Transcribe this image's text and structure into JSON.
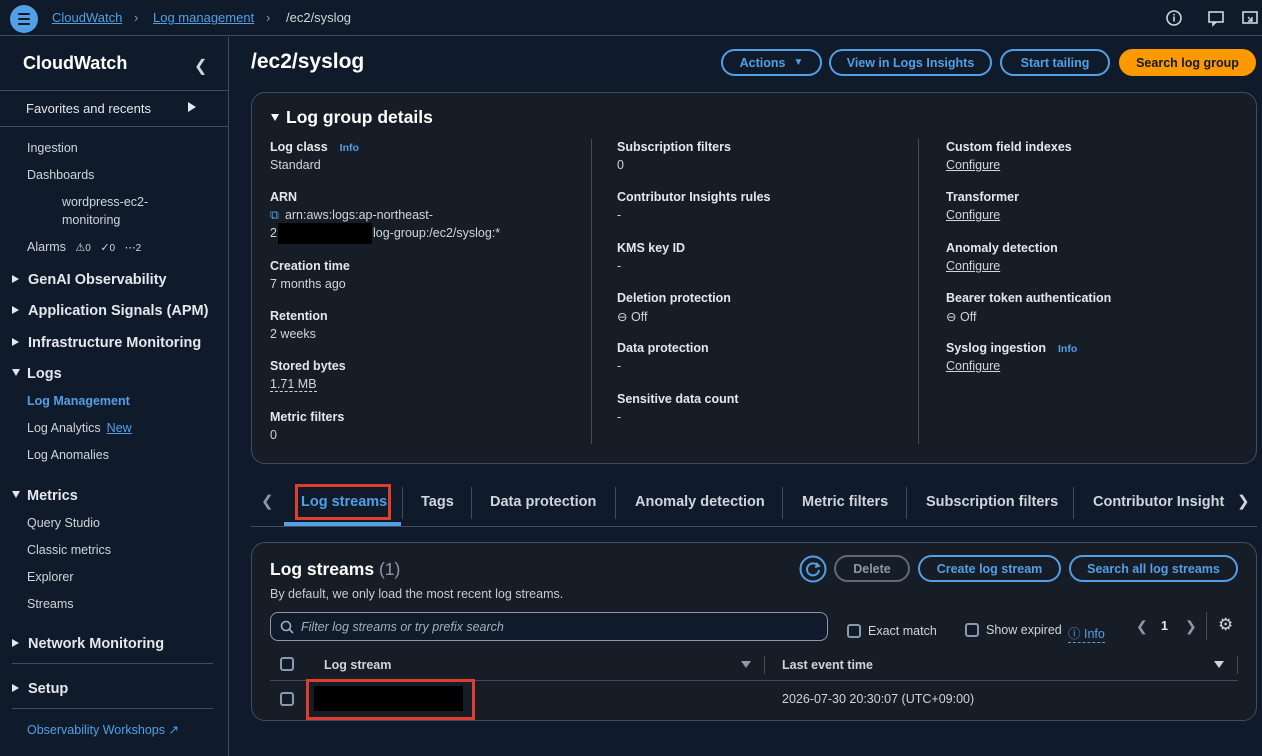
{
  "breadcrumb": {
    "items": [
      "CloudWatch",
      "Log management"
    ],
    "current": "/ec2/syslog"
  },
  "sidebar": {
    "title": "CloudWatch",
    "favorites_label": "Favorites and recents",
    "items": [
      "Ingestion",
      "Dashboards",
      "wordpress-ec2-",
      "monitoring"
    ],
    "alarms_label": "Alarms",
    "alarm_counts": [
      "0",
      "0",
      "2"
    ],
    "groups": {
      "genai": "GenAI Observability",
      "apm": "Application Signals (APM)",
      "infra": "Infrastructure Monitoring",
      "logs": "Logs",
      "metrics": "Metrics",
      "network": "Network Monitoring",
      "setup": "Setup"
    },
    "logs_items": [
      "Log Management",
      "Log Analytics",
      "Log Anomalies"
    ],
    "new_badge": "New",
    "metrics_items": [
      "Query Studio",
      "Classic metrics",
      "Explorer",
      "Streams"
    ],
    "workshops": "Observability Workshops"
  },
  "page": {
    "title": "/ec2/syslog",
    "actions_label": "Actions",
    "insights_label": "View in Logs Insights",
    "tailing_label": "Start tailing",
    "search_group_label": "Search log group"
  },
  "details": {
    "title": "Log group details",
    "info": "Info",
    "col1": {
      "log_class_label": "Log class",
      "log_class_value": "Standard",
      "arn_label": "ARN",
      "arn_line1": "arn:aws:logs:ap-northeast-",
      "arn_line2_prefix": "2",
      "arn_line2_suffix": "log-group:/ec2/syslog:*",
      "creation_label": "Creation time",
      "creation_value": "7 months ago",
      "retention_label": "Retention",
      "retention_value": "2 weeks",
      "stored_label": "Stored bytes",
      "stored_value": "1.71 MB",
      "metric_filters_label": "Metric filters",
      "metric_filters_value": "0"
    },
    "col2": {
      "sub_filters_label": "Subscription filters",
      "sub_filters_value": "0",
      "contrib_label": "Contributor Insights rules",
      "contrib_value": "-",
      "kms_label": "KMS key ID",
      "kms_value": "-",
      "deletion_label": "Deletion protection",
      "deletion_value": "Off",
      "data_prot_label": "Data protection",
      "data_prot_value": "-",
      "sensitive_label": "Sensitive data count",
      "sensitive_value": "-"
    },
    "col3": {
      "custom_idx_label": "Custom field indexes",
      "transformer_label": "Transformer",
      "anomaly_label": "Anomaly detection",
      "bearer_label": "Bearer token authentication",
      "bearer_value": "Off",
      "syslog_label": "Syslog ingestion",
      "configure": "Configure"
    }
  },
  "tabs": [
    "Log streams",
    "Tags",
    "Data protection",
    "Anomaly detection",
    "Metric filters",
    "Subscription filters",
    "Contributor Insight"
  ],
  "streams": {
    "title": "Log streams",
    "count": "(1)",
    "description": "By default, we only load the most recent log streams.",
    "delete_label": "Delete",
    "create_label": "Create log stream",
    "search_all_label": "Search all log streams",
    "filter_placeholder": "Filter log streams or try prefix search",
    "exact_match": "Exact match",
    "show_expired": "Show expired",
    "info": "Info",
    "page_number": "1",
    "columns": [
      "Log stream",
      "Last event time"
    ],
    "rows": [
      {
        "last_event_time": "2026-07-30 20:30:07 (UTC+09:00)"
      }
    ]
  },
  "colors": {
    "accent": "#539fe5",
    "primary_button": "#ff9900",
    "highlight": "#e03e2d",
    "background": "#0f1b2a"
  }
}
